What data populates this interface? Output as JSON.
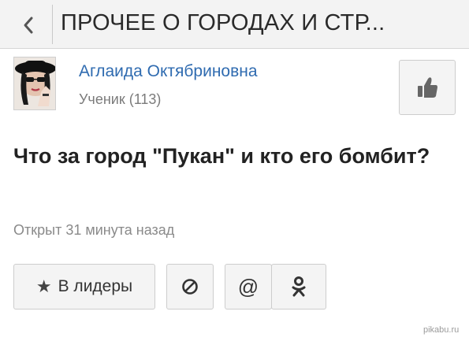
{
  "header": {
    "back_icon": "chevron-left-icon",
    "title": "ПРОЧЕЕ О ГОРОДАХ И СТР..."
  },
  "author": {
    "name": "Аглаида Октябриновна",
    "rank": "Ученик (113)"
  },
  "actions": {
    "like_icon": "thumbs-up-icon"
  },
  "question": {
    "text": "Что за город \"Пукан\" и кто его бомбит?",
    "opened": "Открыт 31 минута назад"
  },
  "buttons": {
    "leaders_icon": "star-icon",
    "leaders_label": "В лидеры",
    "block_icon": "block-icon",
    "mail_icon": "at-icon",
    "mail_glyph": "@",
    "ok_icon": "odnoklassniki-icon"
  },
  "watermark": "pikabu.ru",
  "colors": {
    "link": "#2f6bb0",
    "muted": "#8a8a8a",
    "topbar": "#f3f3f3"
  }
}
